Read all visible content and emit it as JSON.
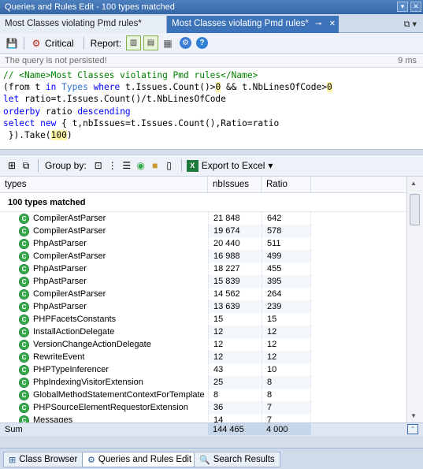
{
  "window": {
    "title": "Queries and Rules Edit  -  100 types matched"
  },
  "tabs": {
    "inactive_label": "Most Classes violating Pmd rules*",
    "active_label": "Most Classes violating Pmd rules*",
    "pin_glyph": "⊸",
    "close_glyph": "✕",
    "menu_glyph": "⧉ ▾"
  },
  "toolbar1": {
    "critical_label": "Critical",
    "report_label": "Report:"
  },
  "status": {
    "message": "The query is not persisted!",
    "elapsed": "9 ms"
  },
  "query": {
    "line1_comment": "// <Name>Most Classes violating Pmd rules</Name>",
    "line2_a": "(from t ",
    "line2_kw1": "in",
    "line2_b": " ",
    "line2_kw2": "Types",
    "line2_c": " ",
    "line2_kw3": "where",
    "line2_d": " t.Issues.Count()>",
    "line2_n1": "0",
    "line2_e": " && t.NbLinesOfCode>",
    "line2_n2": "0",
    "line3_kw": "let",
    "line3_rest": " ratio=t.Issues.Count()/t.NbLinesOfCode",
    "line4_kw1": "orderby",
    "line4_mid": " ratio ",
    "line4_kw2": "descending",
    "line5_kw1": "select",
    "line5_sp": " ",
    "line5_kw2": "new",
    "line5_rest": " { t,nbIssues=t.Issues.Count(),Ratio=ratio",
    "line6_a": " }).Take(",
    "line6_n": "100",
    "line6_b": ")"
  },
  "toolbar2": {
    "group_by_label": "Group by:",
    "export_label": "Export to Excel"
  },
  "grid": {
    "headers": [
      "types",
      "nbIssues",
      "Ratio"
    ],
    "group_label": "100 types matched",
    "rows": [
      {
        "name": "CompilerAstParser",
        "nbIssues": "21 848",
        "ratio": "642"
      },
      {
        "name": "CompilerAstParser",
        "nbIssues": "19 674",
        "ratio": "578"
      },
      {
        "name": "PhpAstParser",
        "nbIssues": "20 440",
        "ratio": "511"
      },
      {
        "name": "CompilerAstParser",
        "nbIssues": "16 988",
        "ratio": "499"
      },
      {
        "name": "PhpAstParser",
        "nbIssues": "18 227",
        "ratio": "455"
      },
      {
        "name": "PhpAstParser",
        "nbIssues": "15 839",
        "ratio": "395"
      },
      {
        "name": "CompilerAstParser",
        "nbIssues": "14 562",
        "ratio": "264"
      },
      {
        "name": "PhpAstParser",
        "nbIssues": "13 639",
        "ratio": "239"
      },
      {
        "name": "PHPFacetsConstants",
        "nbIssues": "15",
        "ratio": "15"
      },
      {
        "name": "InstallActionDelegate",
        "nbIssues": "12",
        "ratio": "12"
      },
      {
        "name": "VersionChangeActionDelegate",
        "nbIssues": "12",
        "ratio": "12"
      },
      {
        "name": "RewriteEvent",
        "nbIssues": "12",
        "ratio": "12"
      },
      {
        "name": "PHPTypeInferencer",
        "nbIssues": "43",
        "ratio": "10"
      },
      {
        "name": "PhpIndexingVisitorExtension",
        "nbIssues": "25",
        "ratio": "8"
      },
      {
        "name": "GlobalMethodStatementContextForTemplate",
        "nbIssues": "8",
        "ratio": "8"
      },
      {
        "name": "PHPSourceElementRequestorExtension",
        "nbIssues": "36",
        "ratio": "7"
      },
      {
        "name": "Messages",
        "nbIssues": "14",
        "ratio": "7"
      }
    ],
    "sum": {
      "label": "Sum",
      "nbIssues": "144 465",
      "ratio": "4 000"
    }
  },
  "bottom_tabs": [
    "Class Browser",
    "Queries and Rules Edit",
    "Search Results"
  ],
  "colors": {
    "title_bar": "#3d73b9",
    "type_icon": "#37a94a",
    "keyword": "#0000ff",
    "comment": "#008000"
  }
}
